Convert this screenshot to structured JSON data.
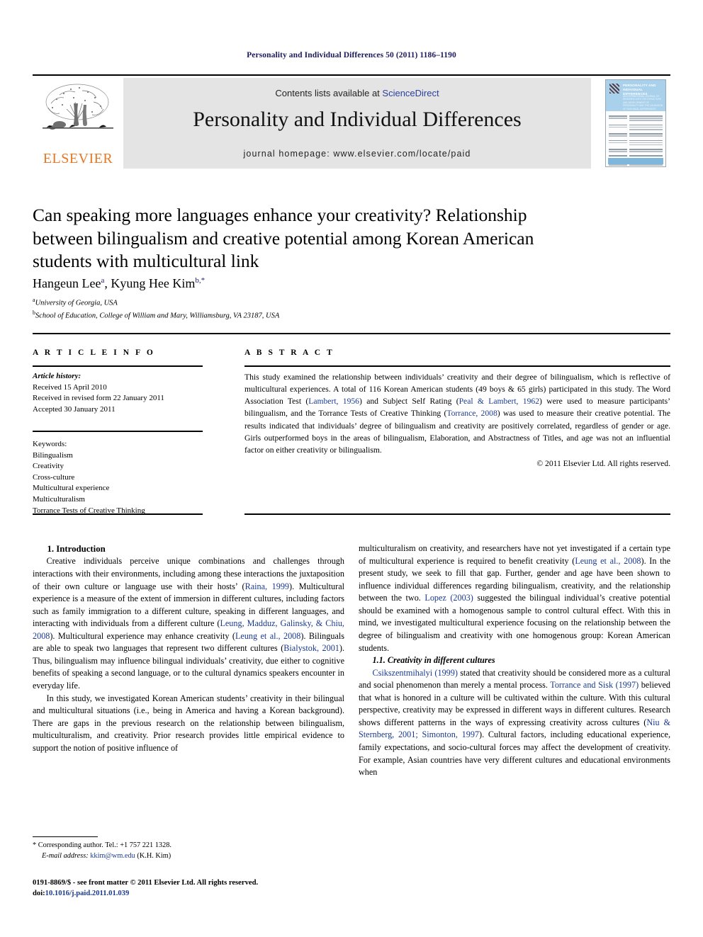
{
  "running_head": "Personality and Individual Differences 50 (2011) 1186–1190",
  "masthead": {
    "publisher": "ELSEVIER",
    "contents_prefix": "Contents lists available at ",
    "contents_link": "ScienceDirect",
    "journal_title": "Personality and Individual Differences",
    "homepage": "journal homepage: www.elsevier.com/locate/paid",
    "cover": {
      "title": "PERSONALITY AND INDIVIDUAL DIFFERENCES",
      "subtitle": "AN INTERNATIONAL JOURNAL OF RESEARCH INTO THE STRUCTURE AND DEVELOPMENT OF PERSONALITY AND THE CAUSATION OF INDIVIDUAL DIFFERENCES"
    }
  },
  "article": {
    "title": "Can speaking more languages enhance your creativity? Relationship between bilingualism and creative potential among Korean American students with multicultural link",
    "authors": "Hangeun Lee",
    "author_sup_a": "a",
    "authors_2": ", Kyung Hee Kim",
    "author_sup_b": "b,*",
    "affiliation_a_sup": "a",
    "affiliation_a": "University of Georgia, USA",
    "affiliation_b_sup": "b",
    "affiliation_b": "School of Education, College of William and Mary, Williamsburg, VA 23187, USA"
  },
  "sections": {
    "article_info_heading": "A R T I C L E   I N F O",
    "abstract_heading": "A B S T R A C T"
  },
  "article_info": {
    "history_label": "Article history:",
    "received": "Received 15 April 2010",
    "revised": "Received in revised form 22 January 2011",
    "accepted": "Accepted 30 January 2011",
    "keywords_label": "Keywords:",
    "keywords": [
      "Bilingualism",
      "Creativity",
      "Cross-culture",
      "Multicultural experience",
      "Multiculturalism",
      "Torrance Tests of Creative Thinking"
    ]
  },
  "abstract": {
    "part1": "This study examined the relationship between individuals’ creativity and their degree of bilingualism, which is reflective of multicultural experiences. A total of 116 Korean American students (49 boys & 65 girls) participated in this study. The Word Association Test (",
    "ref1": "Lambert, 1956",
    "part2": ") and Subject Self Rating (",
    "ref2": "Peal & Lambert, 1962",
    "part3": ") were used to measure participants’ bilingualism, and the Torrance Tests of Creative Thinking (",
    "ref3": "Torrance, 2008",
    "part4": ") was used to measure their creative potential. The results indicated that individuals’ degree of bilingualism and creativity are positively correlated, regardless of gender or age. Girls outperformed boys in the areas of bilingualism, Elaboration, and Abstractness of Titles, and age was not an influential factor on either creativity or bilingualism.",
    "copyright": "© 2011 Elsevier Ltd. All rights reserved."
  },
  "body": {
    "intro_heading": "1. Introduction",
    "p1_a": "Creative individuals perceive unique combinations and challenges through interactions with their environments, including among these interactions the juxtaposition of their own culture or language use with their hosts’ (",
    "p1_ref1": "Raina, 1999",
    "p1_b": "). Multicultural experience is a measure of the extent of immersion in different cultures, including factors such as family immigration to a different culture, speaking in different languages, and interacting with individuals from a different culture (",
    "p1_ref2": "Leung, Madduz, Galinsky, & Chiu, 2008",
    "p1_c": "). Multicultural experience may enhance creativity (",
    "p1_ref3": "Leung et al., 2008",
    "p1_d": "). Bilinguals are able to speak two languages that represent two different cultures (",
    "p1_ref4": "Bialystok, 2001",
    "p1_e": "). Thus, bilingualism may influence bilingual individuals’ creativity, due either to cognitive benefits of speaking a second language, or to the cultural dynamics speakers encounter in everyday life.",
    "p2": "In this study, we investigated Korean American students’ creativity in their bilingual and multicultural situations (i.e., being in America and having a Korean background). There are gaps in the previous research on the relationship between bilingualism, multiculturalism, and creativity. Prior research provides little empirical evidence to support the notion of positive influence of",
    "p3_a": "multiculturalism on creativity, and researchers have not yet investigated if a certain type of multicultural experience is required to benefit creativity (",
    "p3_ref1": "Leung et al., 2008",
    "p3_b": "). In the present study, we seek to fill that gap. Further, gender and age have been shown to influence individual differences regarding bilingualism, creativity, and the relationship between the two. ",
    "p3_ref2": "Lopez (2003)",
    "p3_c": " suggested the bilingual individual’s creative potential should be examined with a homogenous sample to control cultural effect. With this in mind, we investigated multicultural experience focusing on the relationship between the degree of bilingualism and creativity with one homogenous group: Korean American students.",
    "subsec_heading": "1.1. Creativity in different cultures",
    "p4_ref1": "Csikszentmihalyi (1999)",
    "p4_a": " stated that creativity should be considered more as a cultural and social phenomenon than merely a mental process. ",
    "p4_ref2": "Torrance and Sisk (1997)",
    "p4_b": " believed that what is honored in a culture will be cultivated within the culture. With this cultural perspective, creativity may be expressed in different ways in different cultures. Research shows different patterns in the ways of expressing creativity across cultures (",
    "p4_ref3": "Niu & Sternberg, 2001; Simonton, 1997",
    "p4_c": "). Cultural factors, including educational experience, family expectations, and socio-cultural forces may affect the development of creativity. For example, Asian countries have very different cultures and educational environments when"
  },
  "footer": {
    "corresponding": "* Corresponding author. Tel.: +1 757 221 1328.",
    "email_label": "E-mail address:",
    "email": "kkim@wm.edu",
    "email_owner": "(K.H. Kim)",
    "issn_line": "0191-8869/$ - see front matter © 2011 Elsevier Ltd. All rights reserved.",
    "doi_label": "doi:",
    "doi": "10.1016/j.paid.2011.01.039"
  }
}
